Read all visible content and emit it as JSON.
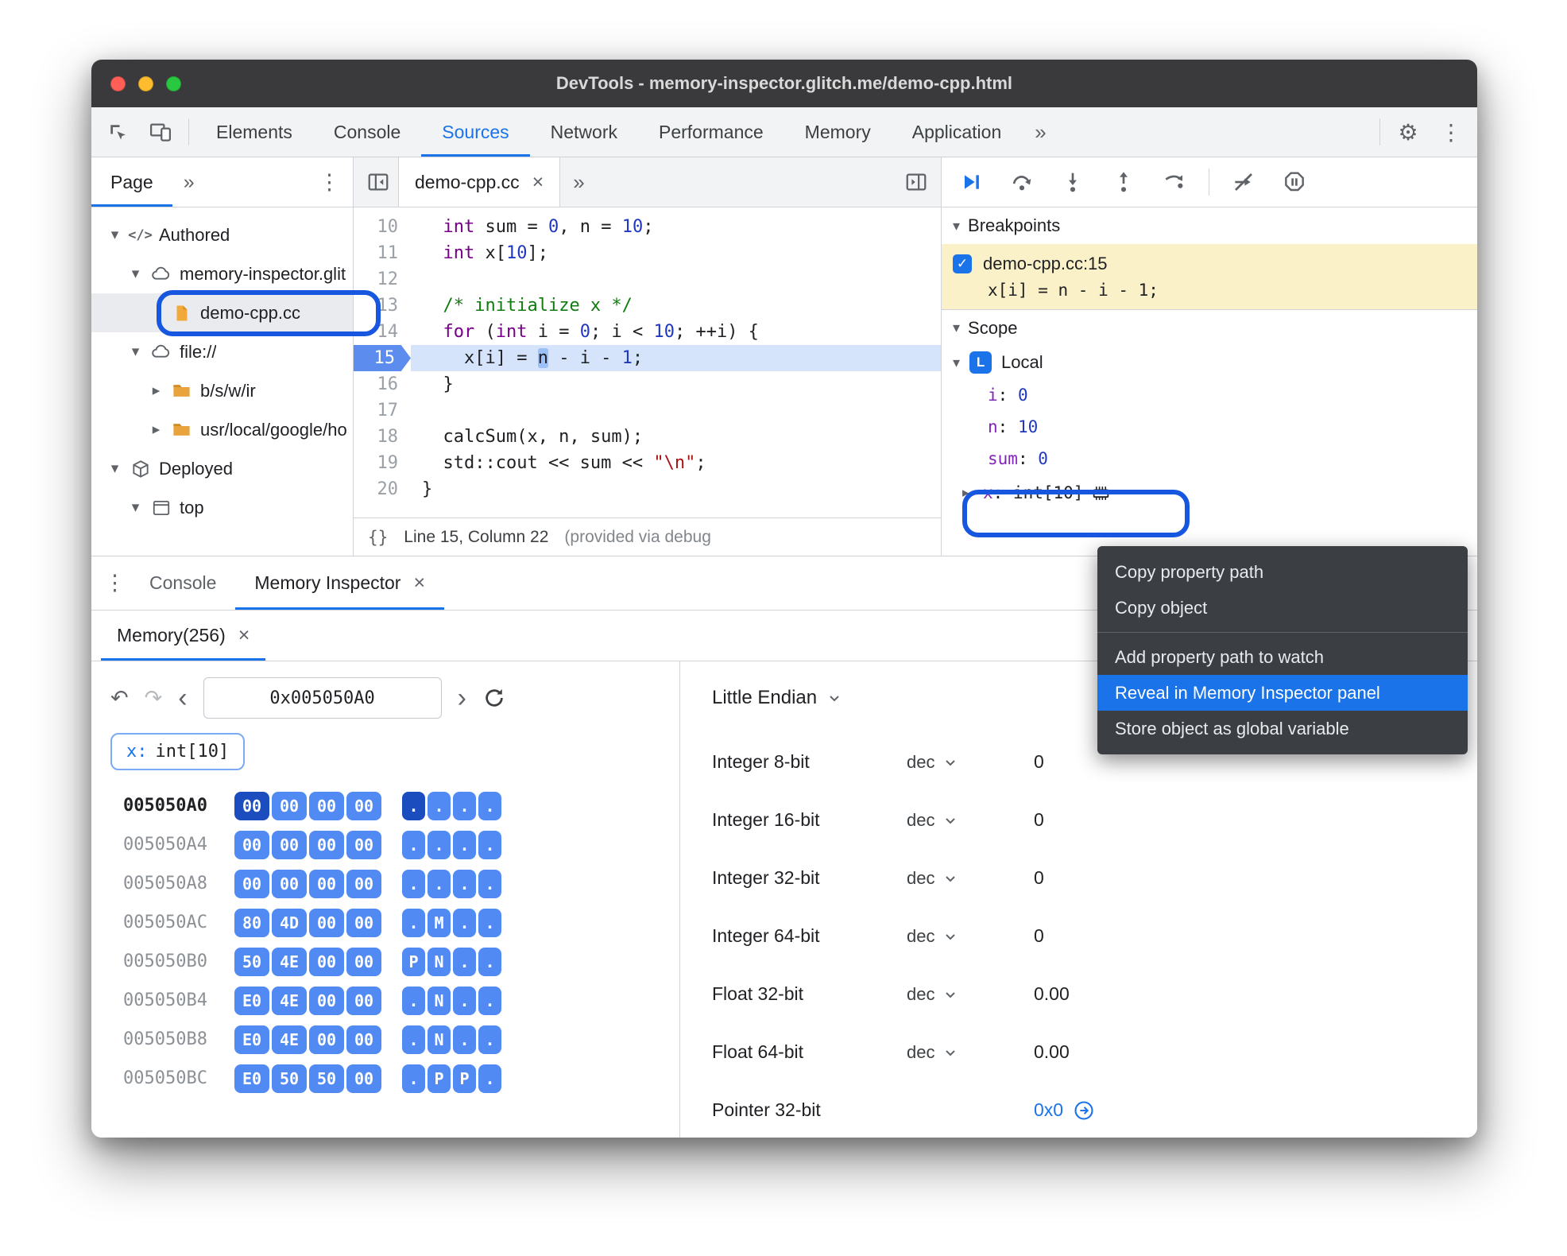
{
  "colors": {
    "accent": "#1a73e8",
    "titlebar-bg": "#3a3a3c",
    "toolbar-bg": "#f1f3f4",
    "traffic-red": "#ff5f57",
    "traffic-yellow": "#febc2e",
    "traffic-green": "#28c840",
    "breakpoint-bg": "#fbf1c8",
    "paused-line-bg": "#d5e3fb",
    "token-highlight-bg": "#9cc1f8",
    "exec-arrow": "#5c8ced",
    "chip-bg": "#528af3",
    "chip-selected-bg": "#1b4dbf",
    "menu-bg": "#3b3f43",
    "ring-blue": "#1757e0",
    "kw": "#770088",
    "num": "#2038c0",
    "comment": "#107c10",
    "string": "#aa1111",
    "varname": "#8324b8"
  },
  "icons": {
    "more": "»",
    "kebab": "⋮",
    "close": "×",
    "chevron_down": "▾",
    "chevron_right": "▸",
    "braces": "{}",
    "undo": "↶",
    "redo": "↷",
    "back": "‹",
    "forward": "›",
    "gear": "⚙",
    "check": "✓"
  },
  "window": {
    "title": "DevTools - memory-inspector.glitch.me/demo-cpp.html"
  },
  "toolbar": {
    "tabs": [
      {
        "label": "Elements"
      },
      {
        "label": "Console"
      },
      {
        "label": "Sources",
        "selected": true
      },
      {
        "label": "Network"
      },
      {
        "label": "Performance"
      },
      {
        "label": "Memory"
      },
      {
        "label": "Application"
      }
    ]
  },
  "sidebar": {
    "tab_label": "Page",
    "tree": [
      {
        "label": "Authored",
        "level": 0,
        "chevron": "down",
        "icon": "code"
      },
      {
        "label": "memory-inspector.glit",
        "level": 1,
        "chevron": "down",
        "icon": "cloud"
      },
      {
        "label": "demo-cpp.cc",
        "level": 2,
        "chevron": "none",
        "icon": "file",
        "selected": true
      },
      {
        "label": "file://",
        "level": 1,
        "chevron": "down",
        "icon": "cloud"
      },
      {
        "label": "b/s/w/ir",
        "level": 2,
        "chevron": "right",
        "icon": "folder"
      },
      {
        "label": "usr/local/google/ho",
        "level": 2,
        "chevron": "right",
        "icon": "folder"
      },
      {
        "label": "Deployed",
        "level": 0,
        "chevron": "down",
        "icon": "package"
      },
      {
        "label": "top",
        "level": 1,
        "chevron": "down",
        "icon": "frame"
      }
    ]
  },
  "editor": {
    "tab_label": "demo-cpp.cc",
    "lines": [
      {
        "no": "10",
        "tokens": [
          [
            "p",
            "  "
          ],
          [
            "k",
            "int"
          ],
          [
            "p",
            " sum = "
          ],
          [
            "n",
            "0"
          ],
          [
            "p",
            ", n = "
          ],
          [
            "n",
            "10"
          ],
          [
            "p",
            ";"
          ]
        ]
      },
      {
        "no": "11",
        "tokens": [
          [
            "p",
            "  "
          ],
          [
            "k",
            "int"
          ],
          [
            "p",
            " x["
          ],
          [
            "n",
            "10"
          ],
          [
            "p",
            "];"
          ]
        ]
      },
      {
        "no": "12",
        "tokens": []
      },
      {
        "no": "13",
        "tokens": [
          [
            "p",
            "  "
          ],
          [
            "c",
            "/* initialize x */"
          ]
        ]
      },
      {
        "no": "14",
        "tokens": [
          [
            "p",
            "  "
          ],
          [
            "k",
            "for"
          ],
          [
            "p",
            " ("
          ],
          [
            "k",
            "int"
          ],
          [
            "p",
            " i = "
          ],
          [
            "n",
            "0"
          ],
          [
            "p",
            "; i < "
          ],
          [
            "n",
            "10"
          ],
          [
            "p",
            "; ++i) {"
          ]
        ]
      },
      {
        "no": "15",
        "current": true,
        "tokens": [
          [
            "p",
            "    x[i] = "
          ],
          [
            "sel",
            "n"
          ],
          [
            "p",
            " - i - "
          ],
          [
            "n",
            "1"
          ],
          [
            "p",
            ";"
          ]
        ]
      },
      {
        "no": "16",
        "tokens": [
          [
            "p",
            "  }"
          ]
        ]
      },
      {
        "no": "17",
        "tokens": []
      },
      {
        "no": "18",
        "tokens": [
          [
            "p",
            "  calcSum(x, n, sum);"
          ]
        ]
      },
      {
        "no": "19",
        "tokens": [
          [
            "p",
            "  std::cout << sum << "
          ],
          [
            "s",
            "\"\\n\""
          ],
          [
            "p",
            ";"
          ]
        ]
      },
      {
        "no": "20",
        "tokens": [
          [
            "p",
            "}"
          ]
        ]
      }
    ],
    "status": {
      "position": "Line 15, Column 22",
      "note": "(provided via debug"
    }
  },
  "debug": {
    "breakpoints_title": "Breakpoints",
    "breakpoint": {
      "location": "demo-cpp.cc:15",
      "condition": "x[i] = n - i - 1;",
      "checked": true
    },
    "scope_title": "Scope",
    "scope_section": {
      "icon_letter": "L",
      "name": "Local"
    },
    "variables": [
      {
        "name": "i",
        "value": "0",
        "type": "number"
      },
      {
        "name": "n",
        "value": "10",
        "type": "number"
      },
      {
        "name": "sum",
        "value": "0",
        "type": "number"
      },
      {
        "name": "x",
        "value": "int[10]",
        "type": "object",
        "expandable": true,
        "memory_icon": true
      }
    ]
  },
  "context_menu": {
    "items": [
      {
        "label": "Copy property path"
      },
      {
        "label": "Copy object"
      },
      {
        "type": "divider"
      },
      {
        "label": "Add property path to watch"
      },
      {
        "label": "Reveal in Memory Inspector panel",
        "highlighted": true
      },
      {
        "label": "Store object as global variable"
      }
    ]
  },
  "drawer": {
    "console_tab": "Console",
    "memory_inspector_tab": "Memory Inspector",
    "memory_tab": "Memory(256)",
    "address_value": "0x005050A0",
    "tag": {
      "name": "x:",
      "type": "int[10]"
    },
    "endian_label": "Little Endian",
    "memory_rows": [
      {
        "addr": "005050A0",
        "current": true,
        "hex": [
          "00",
          "00",
          "00",
          "00"
        ],
        "ascii": [
          ".",
          ".",
          ".",
          "."
        ]
      },
      {
        "addr": "005050A4",
        "hex": [
          "00",
          "00",
          "00",
          "00"
        ],
        "ascii": [
          ".",
          ".",
          ".",
          "."
        ]
      },
      {
        "addr": "005050A8",
        "hex": [
          "00",
          "00",
          "00",
          "00"
        ],
        "ascii": [
          ".",
          ".",
          ".",
          "."
        ]
      },
      {
        "addr": "005050AC",
        "hex": [
          "80",
          "4D",
          "00",
          "00"
        ],
        "ascii": [
          ".",
          "M",
          ".",
          "."
        ]
      },
      {
        "addr": "005050B0",
        "hex": [
          "50",
          "4E",
          "00",
          "00"
        ],
        "ascii": [
          "P",
          "N",
          ".",
          "."
        ]
      },
      {
        "addr": "005050B4",
        "hex": [
          "E0",
          "4E",
          "00",
          "00"
        ],
        "ascii": [
          ".",
          "N",
          ".",
          "."
        ]
      },
      {
        "addr": "005050B8",
        "hex": [
          "E0",
          "4E",
          "00",
          "00"
        ],
        "ascii": [
          ".",
          "N",
          ".",
          "."
        ]
      },
      {
        "addr": "005050BC",
        "hex": [
          "E0",
          "50",
          "50",
          "00"
        ],
        "ascii": [
          ".",
          "P",
          "P",
          "."
        ]
      }
    ],
    "value_rows": [
      {
        "label": "Integer 8-bit",
        "mode": "dec",
        "value": "0"
      },
      {
        "label": "Integer 16-bit",
        "mode": "dec",
        "value": "0"
      },
      {
        "label": "Integer 32-bit",
        "mode": "dec",
        "value": "0"
      },
      {
        "label": "Integer 64-bit",
        "mode": "dec",
        "value": "0"
      },
      {
        "label": "Float 32-bit",
        "mode": "dec",
        "value": "0.00"
      },
      {
        "label": "Float 64-bit",
        "mode": "dec",
        "value": "0.00"
      },
      {
        "label": "Pointer 32-bit",
        "value": "0x0",
        "jump": true
      }
    ]
  }
}
